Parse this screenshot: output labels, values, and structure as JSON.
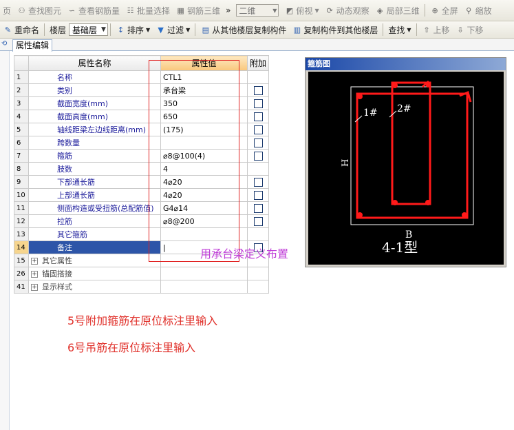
{
  "toolbar1": {
    "items": [
      "页",
      "查找图元",
      "查看钢筋量",
      "批量选择",
      "钢筋三维",
      "»",
      "二维",
      "俯视",
      "动态观察",
      "局部三维",
      "全屏",
      "缩放"
    ]
  },
  "toolbar2": {
    "rename": "重命名",
    "floor_label": "楼层",
    "floor_value": "基础层",
    "sort": "排序",
    "filter": "过滤",
    "copy_from": "从其他楼层复制构件",
    "copy_to": "复制构件到其他楼层",
    "find": "查找",
    "move_up": "上移",
    "move_down": "下移"
  },
  "tab": {
    "label": "属性编辑"
  },
  "grid": {
    "headers": {
      "name": "属性名称",
      "value": "属性值",
      "extra": "附加"
    },
    "rows": [
      {
        "num": "1",
        "name": "名称",
        "value": "CTL1",
        "checkbox": false
      },
      {
        "num": "2",
        "name": "类别",
        "value": "承台梁",
        "checkbox": true
      },
      {
        "num": "3",
        "name": "截面宽度(mm)",
        "value": "350",
        "checkbox": true
      },
      {
        "num": "4",
        "name": "截面高度(mm)",
        "value": "650",
        "checkbox": true
      },
      {
        "num": "5",
        "name": "轴线距梁左边线距离(mm)",
        "value": "(175)",
        "checkbox": true
      },
      {
        "num": "6",
        "name": "跨数量",
        "value": "",
        "checkbox": true
      },
      {
        "num": "7",
        "name": "箍筋",
        "value": "⌀8@100(4)",
        "checkbox": true
      },
      {
        "num": "8",
        "name": "肢数",
        "value": "4",
        "checkbox": false
      },
      {
        "num": "9",
        "name": "下部通长筋",
        "value": "4⌀20",
        "checkbox": true
      },
      {
        "num": "10",
        "name": "上部通长筋",
        "value": "4⌀20",
        "checkbox": true
      },
      {
        "num": "11",
        "name": "侧面构造或受扭筋(总配筋值)",
        "value": "G4⌀14",
        "checkbox": true
      },
      {
        "num": "12",
        "name": "拉筋",
        "value": "⌀8@200",
        "checkbox": true
      },
      {
        "num": "13",
        "name": "其它箍筋",
        "value": "",
        "checkbox": false
      },
      {
        "num": "14",
        "name": "备注",
        "value": "|",
        "checkbox": true
      },
      {
        "num": "15",
        "name": "其它属性",
        "value": "",
        "checkbox": false
      },
      {
        "num": "26",
        "name": "锚固搭接",
        "value": "",
        "checkbox": false
      },
      {
        "num": "41",
        "name": "显示样式",
        "value": "",
        "checkbox": false
      }
    ]
  },
  "panel": {
    "title": "箍筋图",
    "label_1": "1#",
    "label_2": "2#",
    "label_h": "H",
    "label_b": "B",
    "type_label": "4-1型"
  },
  "annotations": {
    "purple": "用承台梁定义布置",
    "red_line1": "5号附加箍筋在原位标注里输入",
    "red_line2": "6号吊筋在原位标注里输入"
  },
  "colors": {
    "annotation_red": "#e0302a",
    "annotation_purple": "#c040d8",
    "rebar_red": "#ff1a1a",
    "selection_blue": "#2d55a8"
  }
}
